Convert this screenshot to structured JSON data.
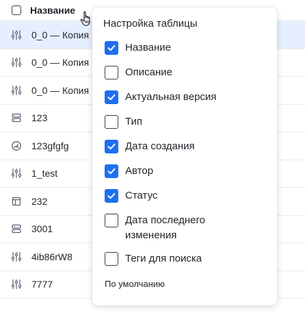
{
  "table": {
    "header": {
      "title": "Название"
    },
    "rows": [
      {
        "icon": "sliders-icon",
        "name": "0_0 — Копия",
        "selected": true
      },
      {
        "icon": "sliders-icon",
        "name": "0_0 — Копия"
      },
      {
        "icon": "sliders-icon",
        "name": "0_0 — Копия"
      },
      {
        "icon": "server-icon",
        "name": "123"
      },
      {
        "icon": "gauge-icon",
        "name": "123gfgfg"
      },
      {
        "icon": "sliders-icon",
        "name": "1_test"
      },
      {
        "icon": "layout-icon",
        "name": "232"
      },
      {
        "icon": "server-icon",
        "name": "3001"
      },
      {
        "icon": "sliders-icon",
        "name": "4ib86rW8"
      },
      {
        "icon": "sliders-icon",
        "name": "7777"
      }
    ]
  },
  "popup": {
    "title": "Настройка таблицы",
    "options": [
      {
        "label": "Название",
        "checked": true
      },
      {
        "label": "Описание",
        "checked": false
      },
      {
        "label": "Актуальная версия",
        "checked": true
      },
      {
        "label": "Тип",
        "checked": false
      },
      {
        "label": "Дата создания",
        "checked": true
      },
      {
        "label": "Автор",
        "checked": true
      },
      {
        "label": "Статус",
        "checked": true
      },
      {
        "label": "Дата последнего изменения",
        "checked": false
      },
      {
        "label": "Теги для поиска",
        "checked": false
      }
    ],
    "reset_label": "По умолчанию"
  },
  "colors": {
    "accent": "#1e6ff2",
    "selected_row": "#e6efff"
  }
}
